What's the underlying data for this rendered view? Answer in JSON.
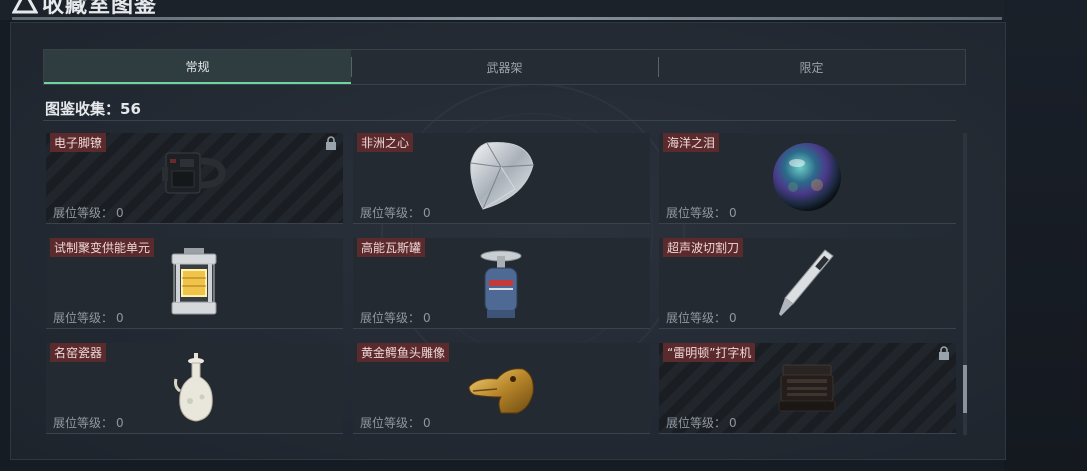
{
  "window": {
    "title": "收藏室图鉴"
  },
  "tabs": [
    {
      "label": "常规",
      "active": true
    },
    {
      "label": "武器架",
      "active": false
    },
    {
      "label": "限定",
      "active": false
    }
  ],
  "collection": {
    "label": "图鉴收集：",
    "count": "56"
  },
  "items": [
    {
      "name": "电子脚镣",
      "level_label": "展位等级：",
      "level": "0",
      "locked": true,
      "icon": "ankle-monitor-icon"
    },
    {
      "name": "非洲之心",
      "level_label": "展位等级：",
      "level": "0",
      "locked": false,
      "icon": "diamond-icon"
    },
    {
      "name": "海洋之泪",
      "level_label": "展位等级：",
      "level": "0",
      "locked": false,
      "icon": "pearl-orb-icon"
    },
    {
      "name": "试制聚变供能单元",
      "level_label": "展位等级：",
      "level": "0",
      "locked": false,
      "icon": "fusion-cell-icon"
    },
    {
      "name": "高能瓦斯罐",
      "level_label": "展位等级：",
      "level": "0",
      "locked": false,
      "icon": "gas-canister-icon"
    },
    {
      "name": "超声波切割刀",
      "level_label": "展位等级：",
      "level": "0",
      "locked": false,
      "icon": "ultrasonic-knife-icon"
    },
    {
      "name": "名窑瓷器",
      "level_label": "展位等级：",
      "level": "0",
      "locked": false,
      "icon": "porcelain-vase-icon"
    },
    {
      "name": "黄金鳄鱼头雕像",
      "level_label": "展位等级：",
      "level": "0",
      "locked": false,
      "icon": "gold-crocodile-icon"
    },
    {
      "name": "“雷明顿”打字机",
      "level_label": "展位等级：",
      "level": "0",
      "locked": true,
      "icon": "typewriter-icon"
    }
  ],
  "colors": {
    "accent": "#6fd4a0",
    "name_tag_bg": "#5a2a2d",
    "panel_bg": "#232a33"
  }
}
